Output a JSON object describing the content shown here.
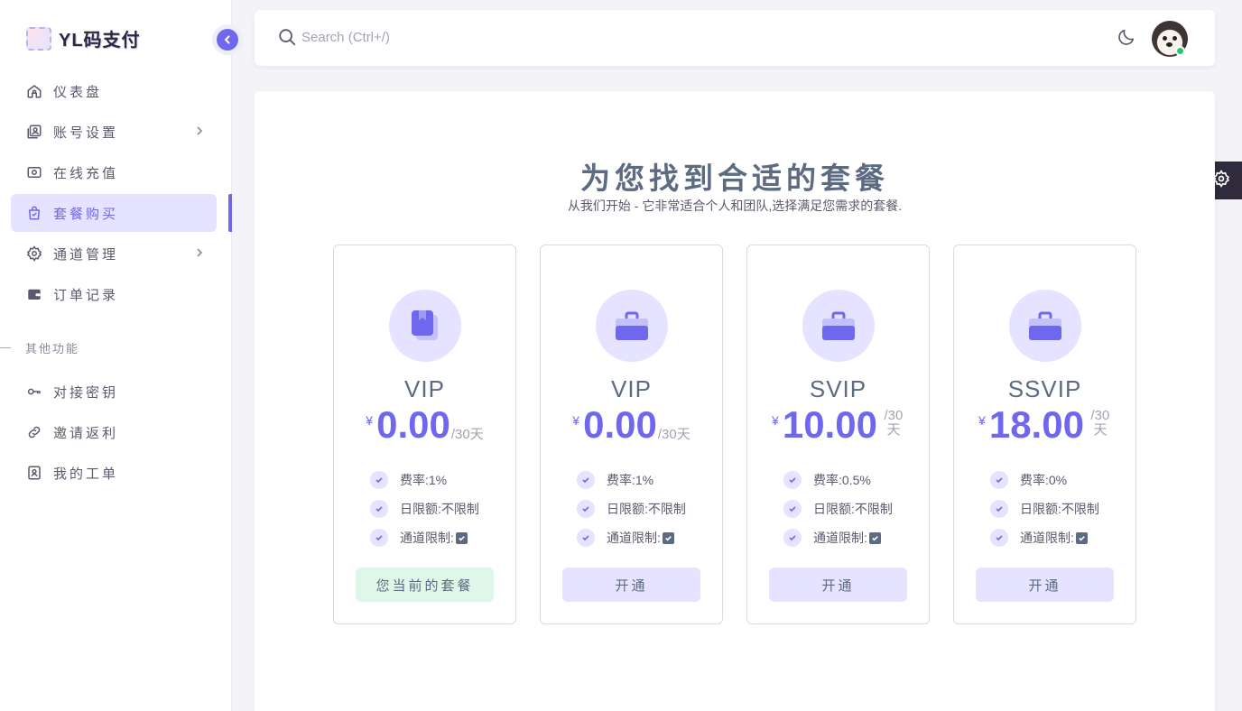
{
  "brand": {
    "name": "YL码支付"
  },
  "sidebar": {
    "items": [
      {
        "label": "仪表盘",
        "icon": "home-icon"
      },
      {
        "label": "账号设置",
        "icon": "account-icon",
        "has_submenu": true
      },
      {
        "label": "在线充值",
        "icon": "recharge-icon"
      },
      {
        "label": "套餐购买",
        "icon": "shopping-bag-icon",
        "active": true
      },
      {
        "label": "通道管理",
        "icon": "gear-icon",
        "has_submenu": true
      },
      {
        "label": "订单记录",
        "icon": "wallet-icon"
      }
    ],
    "section_label": "其他功能",
    "other_items": [
      {
        "label": "对接密钥",
        "icon": "key-icon"
      },
      {
        "label": "邀请返利",
        "icon": "link-icon"
      },
      {
        "label": "我的工单",
        "icon": "ticket-icon"
      }
    ]
  },
  "topbar": {
    "search_placeholder": "Search (Ctrl+/)",
    "theme_icon": "moon-icon",
    "status": "online"
  },
  "page": {
    "title": "为您找到合适的套餐",
    "subtitle": "从我们开始 - 它非常适合个人和团队,选择满足您需求的套餐."
  },
  "plans": [
    {
      "name": "VIP",
      "currency": "¥",
      "price": "0.00",
      "period": "/30天",
      "fee_label": "费率:",
      "fee": "1%",
      "limit_label": "日限额:",
      "limit": "不限制",
      "channel_label": "通道限制:",
      "channel_checked": true,
      "button": "您当前的套餐",
      "is_current": true,
      "icon": "book-icon"
    },
    {
      "name": "VIP",
      "currency": "¥",
      "price": "0.00",
      "period": "/30天",
      "fee_label": "费率:",
      "fee": "1%",
      "limit_label": "日限额:",
      "limit": "不限制",
      "channel_label": "通道限制:",
      "channel_checked": true,
      "button": "开通",
      "is_current": false,
      "icon": "briefcase-icon"
    },
    {
      "name": "SVIP",
      "currency": "¥",
      "price": "10.00",
      "period_num": "/30",
      "period_unit": "天",
      "fee_label": "费率:",
      "fee": "0.5%",
      "limit_label": "日限额:",
      "limit": "不限制",
      "channel_label": "通道限制:",
      "channel_checked": true,
      "button": "开通",
      "is_current": false,
      "icon": "briefcase-icon"
    },
    {
      "name": "SSVIP",
      "currency": "¥",
      "price": "18.00",
      "period_num": "/30",
      "period_unit": "天",
      "fee_label": "费率:",
      "fee": "0%",
      "limit_label": "日限额:",
      "limit": "不限制",
      "channel_label": "通道限制:",
      "channel_checked": true,
      "button": "开通",
      "is_current": false,
      "icon": "briefcase-icon"
    }
  ],
  "colors": {
    "primary": "#6f68ee",
    "primary_light": "#e5e3ff",
    "success_light": "#dff7e9",
    "heading": "#5d6b82"
  }
}
